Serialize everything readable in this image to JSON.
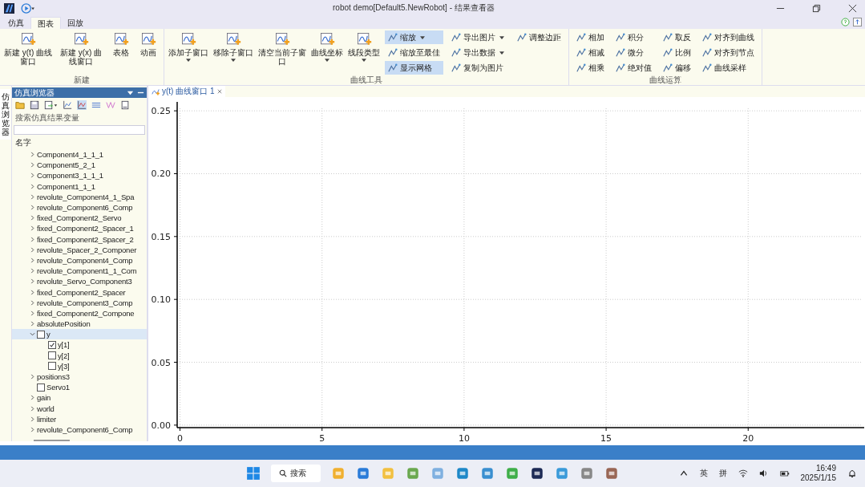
{
  "window": {
    "title": "robot demo[Default5.NewRobot] - 结果查看器"
  },
  "menu_tabs": [
    {
      "label": "仿真",
      "selected": false
    },
    {
      "label": "图表",
      "selected": true
    },
    {
      "label": "回放",
      "selected": false
    }
  ],
  "ribbon": {
    "groups": [
      {
        "label": "新建",
        "large": [
          {
            "label": "新建 y(t) 曲线窗口"
          },
          {
            "label": "新建 y(x) 曲线窗口"
          },
          {
            "label": "表格"
          },
          {
            "label": "动画"
          }
        ]
      },
      {
        "label": "曲线工具",
        "large": [
          {
            "label": "添加子窗口",
            "dropdown": true
          },
          {
            "label": "移除子窗口",
            "dropdown": true
          },
          {
            "label": "清空当前子窗口"
          },
          {
            "label": "曲线坐标",
            "dropdown": true
          },
          {
            "label": "线段类型",
            "dropdown": true
          }
        ],
        "columns": [
          [
            {
              "label": "缩放",
              "on": true,
              "dropdown": true
            },
            {
              "label": "缩放至最佳",
              "on": false
            },
            {
              "label": "显示网格",
              "on": true
            }
          ],
          [
            {
              "label": "导出图片",
              "on": false,
              "dropdown": true
            },
            {
              "label": "导出数据",
              "on": false,
              "dropdown": true
            },
            {
              "label": "复制为图片",
              "on": false
            }
          ],
          [
            {
              "label": "调整边距",
              "on": false
            }
          ]
        ]
      },
      {
        "label": "曲线运算",
        "columns": [
          [
            {
              "label": "相加",
              "on": false
            },
            {
              "label": "相减",
              "on": false
            },
            {
              "label": "相乘",
              "on": false
            }
          ],
          [
            {
              "label": "积分",
              "on": false
            },
            {
              "label": "微分",
              "on": false
            },
            {
              "label": "绝对值",
              "on": false
            }
          ],
          [
            {
              "label": "取反",
              "on": false
            },
            {
              "label": "比例",
              "on": false
            },
            {
              "label": "偏移",
              "on": false
            }
          ],
          [
            {
              "label": "对齐到曲线",
              "on": false
            },
            {
              "label": "对齐到节点",
              "on": false
            },
            {
              "label": "曲线采样",
              "on": false
            }
          ]
        ]
      }
    ]
  },
  "side_tab": {
    "label": "仿真浏览器"
  },
  "browser": {
    "title": "仿真浏览器",
    "search": {
      "placeholder": "搜索仿真结果变量"
    },
    "column": "名字",
    "tree": [
      {
        "label": "Component4_1_1_1",
        "kind": "node",
        "expanded": false
      },
      {
        "label": "Component5_2_1",
        "kind": "node",
        "expanded": false
      },
      {
        "label": "Component3_1_1_1",
        "kind": "node",
        "expanded": false
      },
      {
        "label": "Component1_1_1",
        "kind": "node",
        "expanded": false
      },
      {
        "label": "revolute_Component4_1_Spa",
        "kind": "node",
        "expanded": false
      },
      {
        "label": "revolute_Component6_Comp",
        "kind": "node",
        "expanded": false
      },
      {
        "label": "fixed_Component2_Servo",
        "kind": "node",
        "expanded": false
      },
      {
        "label": "fixed_Component2_Spacer_1",
        "kind": "node",
        "expanded": false
      },
      {
        "label": "fixed_Component2_Spacer_2",
        "kind": "node",
        "expanded": false
      },
      {
        "label": "revolute_Spacer_2_Componer",
        "kind": "node",
        "expanded": false
      },
      {
        "label": "revolute_Component4_Comp",
        "kind": "node",
        "expanded": false
      },
      {
        "label": "revolute_Component1_1_Com",
        "kind": "node",
        "expanded": false
      },
      {
        "label": "revolute_Servo_Component3",
        "kind": "node",
        "expanded": false
      },
      {
        "label": "fixed_Component2_Spacer",
        "kind": "node",
        "expanded": false
      },
      {
        "label": "revolute_Component3_Comp",
        "kind": "node",
        "expanded": false
      },
      {
        "label": "fixed_Component2_Compone",
        "kind": "node",
        "expanded": false
      },
      {
        "label": "absolutePosition",
        "kind": "node",
        "expanded": false
      },
      {
        "label": "y",
        "kind": "signal-group",
        "expanded": true,
        "checked": false,
        "selected": true,
        "children": [
          {
            "label": "y[1]",
            "kind": "signal",
            "checked": true
          },
          {
            "label": "y[2]",
            "kind": "signal",
            "checked": false
          },
          {
            "label": "y[3]",
            "kind": "signal",
            "checked": false
          }
        ]
      },
      {
        "label": "positions3",
        "kind": "node",
        "expanded": false
      },
      {
        "label": "Servo1",
        "kind": "signal",
        "checked": false
      },
      {
        "label": "gain",
        "kind": "node",
        "expanded": false
      },
      {
        "label": "world",
        "kind": "node",
        "expanded": false
      },
      {
        "label": "limiter",
        "kind": "node",
        "expanded": false
      },
      {
        "label": "revolute_Component6_Comp",
        "kind": "node",
        "expanded": false
      }
    ]
  },
  "doc_tab": {
    "label": "y(t) 曲线窗口 1",
    "selected": true
  },
  "plot": {
    "chart_data": {
      "type": "line",
      "grid": true,
      "xlim": [
        -0.1,
        24
      ],
      "ylim": [
        -0.002,
        0.252
      ],
      "xticks": [
        0,
        5,
        10,
        15,
        20
      ],
      "yticks": [
        {
          "value": 0,
          "label": "0.00"
        },
        {
          "value": 0.05,
          "label": "0.05"
        },
        {
          "value": 0.1,
          "label": "0.10"
        },
        {
          "value": 0.15,
          "label": "0.15"
        },
        {
          "value": 0.2,
          "label": "0.20"
        },
        {
          "value": 0.25,
          "label": "0.25"
        }
      ]
    }
  },
  "taskbar": {
    "search": {
      "placeholder": "搜索"
    },
    "tray": [
      "英",
      "拼"
    ],
    "time": "16:49",
    "date": "2025/1/15"
  }
}
